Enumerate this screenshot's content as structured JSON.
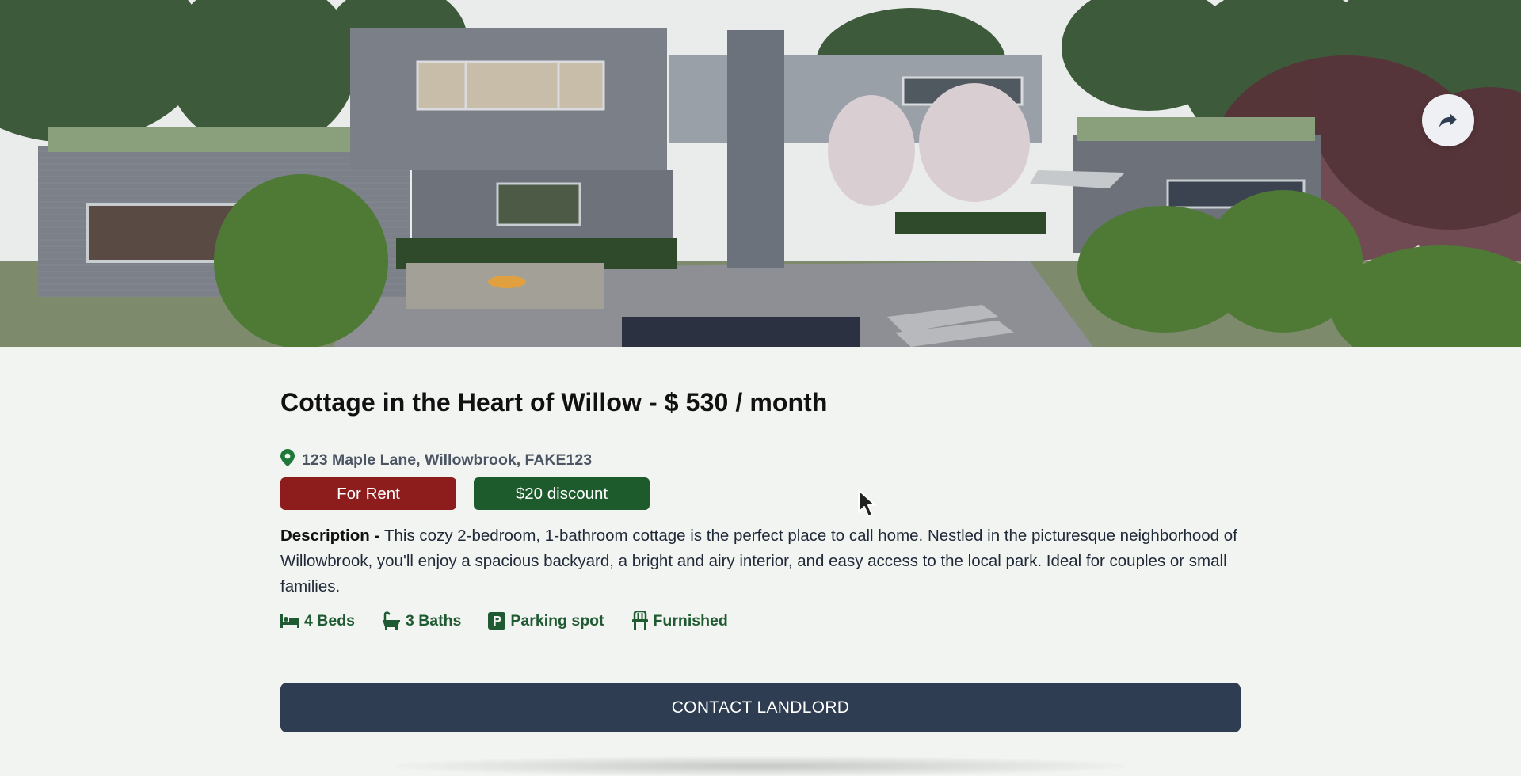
{
  "listing": {
    "title": "Cottage in the Heart of Willow - $ 530 / month",
    "address": "123 Maple Lane, Willowbrook, FAKE123",
    "status_badge": "For Rent",
    "discount_badge": "$20 discount",
    "description_label": "Description - ",
    "description_text": "This cozy 2-bedroom, 1-bathroom cottage is the perfect place to call home. Nestled in the picturesque neighborhood of Willowbrook, you'll enjoy a spacious backyard, a bright and airy interior, and easy access to the local park. Ideal for couples or small families.",
    "amenities": [
      {
        "icon": "bed-icon",
        "label": "4 Beds"
      },
      {
        "icon": "bathtub-icon",
        "label": "3 Baths"
      },
      {
        "icon": "parking-icon",
        "label": "Parking spot"
      },
      {
        "icon": "chair-icon",
        "label": "Furnished"
      }
    ],
    "contact_label": "CONTACT LANDLORD"
  },
  "hero": {
    "image": "modern-house-photo",
    "share_icon": "share-icon"
  },
  "colors": {
    "for_rent": "#8d1c1c",
    "discount": "#1d5a2c",
    "amenity_text": "#1f5a32",
    "contact_button": "#2f3d52",
    "background": "#f2f4f1",
    "location_pin": "#1f7a3a"
  }
}
